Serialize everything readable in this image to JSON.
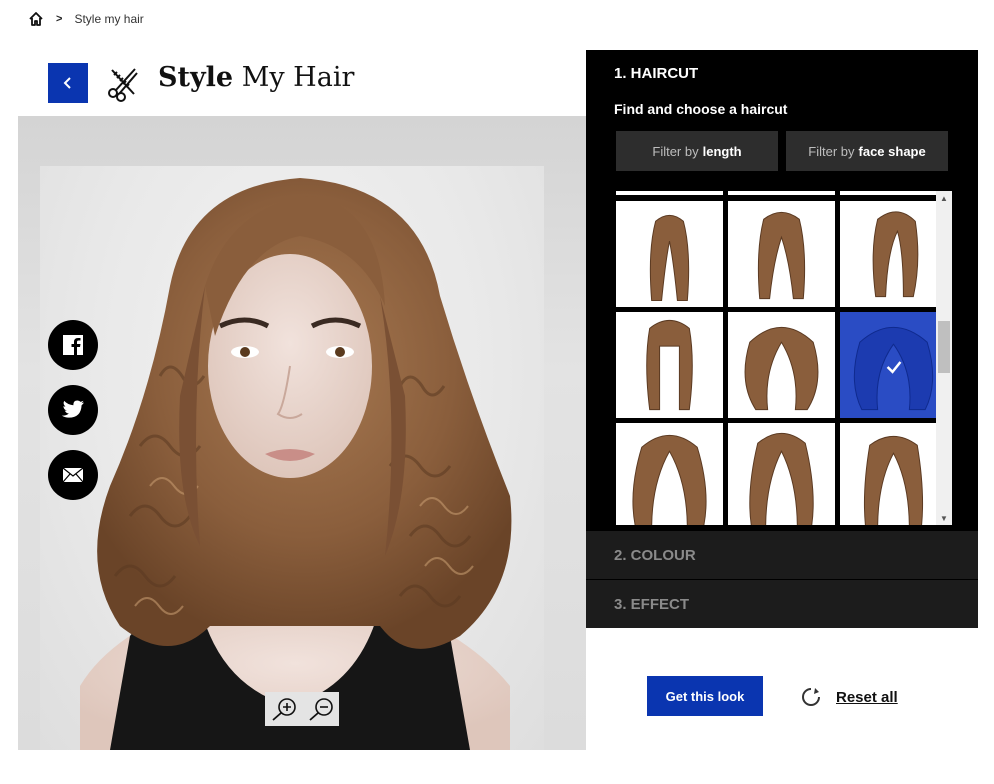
{
  "breadcrumb": {
    "home_icon": "home-icon",
    "separator": ">",
    "current": "Style my hair"
  },
  "header": {
    "back_icon": "chevron-left-icon",
    "tool_icon": "scissors-comb-icon",
    "title_bold": "Style",
    "title_rest": "My Hair"
  },
  "social": [
    {
      "name": "facebook",
      "icon": "facebook-icon"
    },
    {
      "name": "twitter",
      "icon": "twitter-icon"
    },
    {
      "name": "email",
      "icon": "envelope-icon"
    }
  ],
  "zoom": {
    "in_icon": "zoom-in-icon",
    "out_icon": "zoom-out-icon"
  },
  "panel": {
    "step1_title": "1. HAIRCUT",
    "find_text": "Find and choose a haircut",
    "filters": [
      {
        "prefix": "Filter by",
        "bold": "length"
      },
      {
        "prefix": "Filter by",
        "bold": "face shape"
      }
    ],
    "gallery": {
      "selected_index": 5,
      "styles": [
        "long straight top knot",
        "long wavy half-up",
        "long straight side part",
        "long straight with bangs",
        "medium wavy voluminous",
        "medium curly",
        "long curly",
        "long wavy",
        "long wavy layered"
      ]
    },
    "step2_title": "2. COLOUR",
    "step3_title": "3. EFFECT"
  },
  "actions": {
    "get_look": "Get this look",
    "reset_label": "Reset all",
    "reset_icon": "reset-icon"
  },
  "colors": {
    "accent": "#0a35b0",
    "panel_bg": "#000000",
    "accordion_bg": "#1c1c1c",
    "selected_tile": "#2a4cc4",
    "hair": "#8a5e3c"
  }
}
